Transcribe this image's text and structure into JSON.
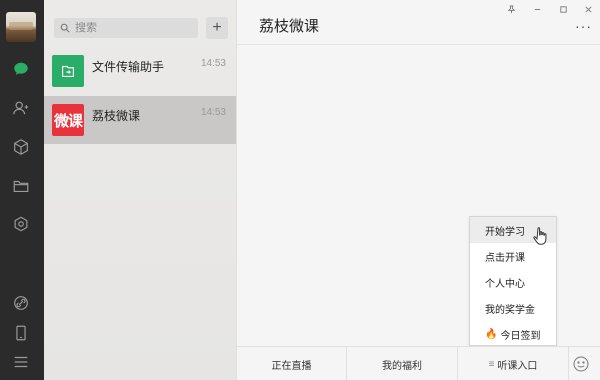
{
  "sidebar": {
    "icons": [
      "chat-icon",
      "contacts-icon",
      "cube-icon",
      "folder-icon",
      "settings-icon",
      "link-icon",
      "phone-icon",
      "menu-icon"
    ]
  },
  "search": {
    "placeholder": "搜索"
  },
  "chats": [
    {
      "name": "文件传输助手",
      "time": "14:53",
      "icon": "file-transfer-icon",
      "color": "#2aae67"
    },
    {
      "name": "荔枝微课",
      "time": "14:53",
      "icon_text": "微课",
      "color": "#e8323c"
    }
  ],
  "window": {
    "title": "荔枝微课",
    "more": "···"
  },
  "menu": {
    "items": [
      "开始学习",
      "点击开课",
      "个人中心",
      "我的奖学金",
      "今日签到"
    ],
    "fire_icon": "🔥"
  },
  "bottom_tabs": [
    "正在直播",
    "我的福利",
    "听课入口"
  ],
  "colors": {
    "accent_green": "#2aae67",
    "brand_red": "#e8323c",
    "rail": "#2b2b2b"
  }
}
